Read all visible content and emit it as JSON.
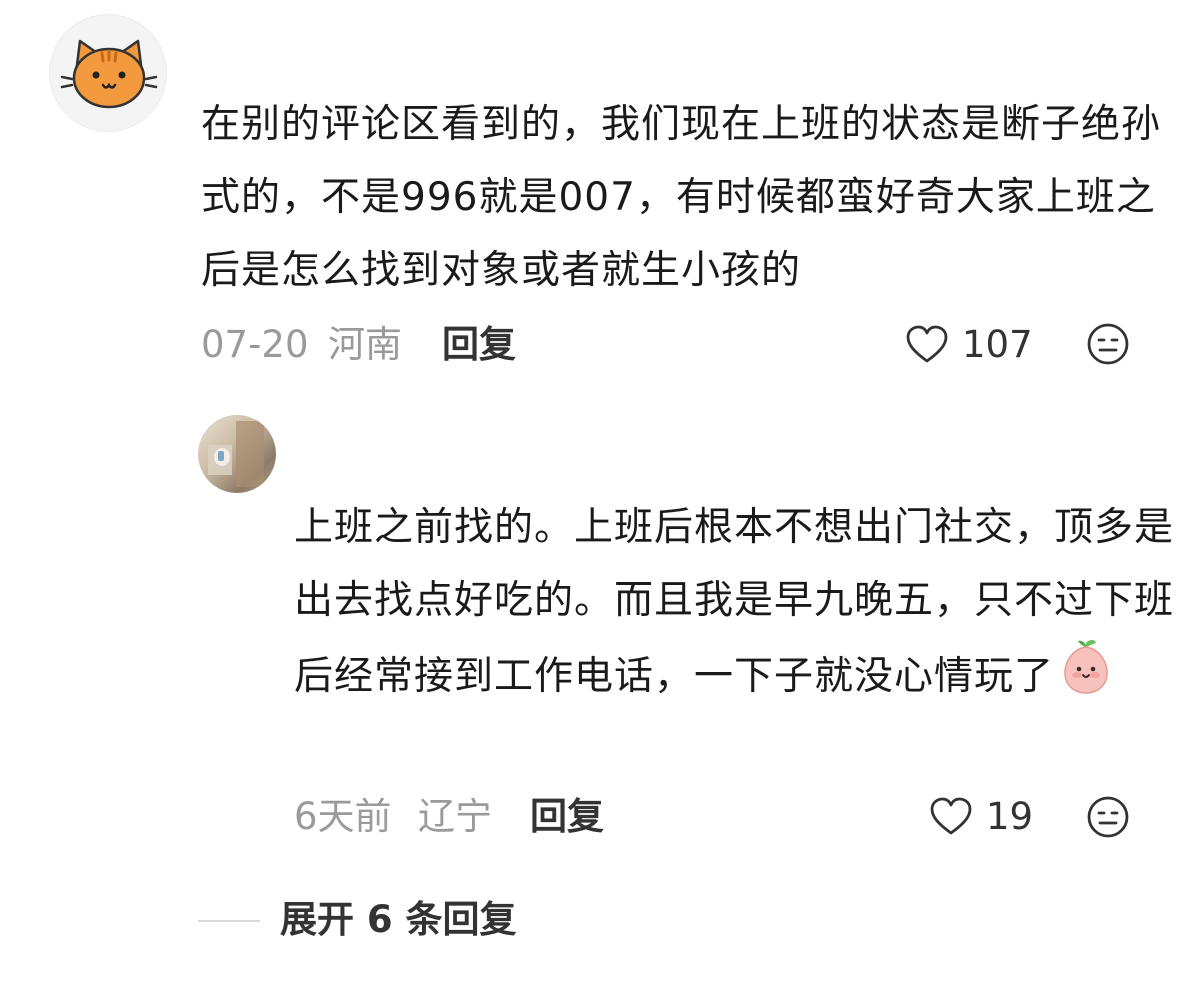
{
  "comment": {
    "avatar": "orange-cat-avatar",
    "text": "在别的评论区看到的，我们现在上班的状态是断子绝孙式的，不是996就是007，有时候都蛮好奇大家上班之后是怎么找到对象或者就生小孩的",
    "date": "07-20",
    "location": "河南",
    "reply_label": "回复",
    "like_count": "107",
    "like_icon": "heart-outline-icon",
    "emoji_icon": "face-emoji-icon"
  },
  "reply": {
    "avatar": "photo-avatar",
    "text": "上班之前找的。上班后根本不想出门社交，顶多是出去找点好吃的。而且我是早九晚五，只不过下班后经常接到工作电话，一下子就没心情玩了",
    "inline_emoji": "peach-face-emoji",
    "date": "6天前",
    "location": "辽宁",
    "reply_label": "回复",
    "like_count": "19",
    "like_icon": "heart-outline-icon",
    "emoji_icon": "face-emoji-icon"
  },
  "expand": {
    "label": "展开 6 条回复"
  },
  "colors": {
    "text": "#1a1a1a",
    "meta": "#9a9a9a",
    "action": "#333333",
    "cat": "#f39a3e"
  }
}
